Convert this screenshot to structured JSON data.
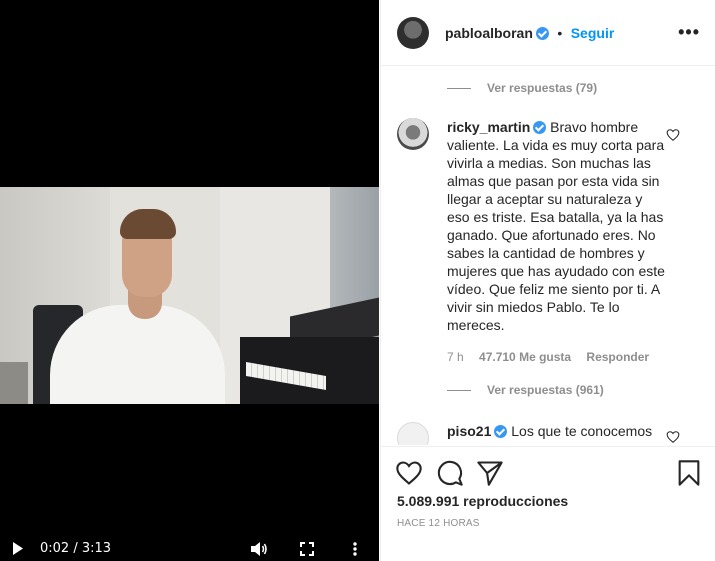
{
  "post": {
    "author": "pabloalboran",
    "follow_label": "Seguir",
    "separator": "•",
    "more_label": "•••"
  },
  "video": {
    "current_time": "0:02",
    "duration": "3:13",
    "time_display": "0:02 / 3:13",
    "icons": [
      "play-icon",
      "volume-icon",
      "fullscreen-icon",
      "more-vertical-icon"
    ]
  },
  "comments": {
    "replies_top": "Ver respuestas (79)",
    "items": [
      {
        "username": "ricky_martin",
        "verified": true,
        "text": "Bravo hombre valiente. La vida es muy corta para vivirla a medias. Son muchas las almas que pasan por esta vida sin llegar a aceptar su naturaleza y eso es triste. Esa batalla, ya la has ganado. Que afortunado eres. No sabes la cantidad de hombres y mujeres que has ayudado con este vídeo. Que feliz me siento por ti. A vivir sin miedos Pablo. Te lo mereces.",
        "time": "7 h",
        "likes": "47.710 Me gusta",
        "reply_label": "Responder",
        "replies": "Ver respuestas (961)"
      },
      {
        "username": "piso21",
        "verified": true,
        "text": "Los que te conocemos"
      }
    ]
  },
  "footer": {
    "views": "5.089.991 reproducciones",
    "posted_ago": "HACE 12 HORAS"
  },
  "colors": {
    "verified": "#3897f0",
    "follow": "#0095f6",
    "muted": "#8e8e8e",
    "text": "#262626"
  }
}
